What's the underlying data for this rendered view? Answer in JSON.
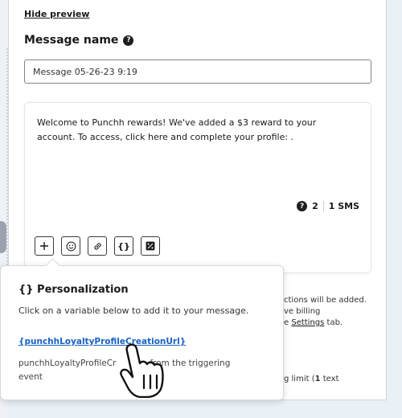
{
  "preview": {
    "hide_label": "Hide preview"
  },
  "message_name": {
    "label": "Message name",
    "help_icon": "help-icon",
    "value": "Message 05-26-23 9:19"
  },
  "composer": {
    "text": "Welcome to Punchh rewards! We've added a $3 reward to your account. To access, click here and complete your profile: .",
    "sms_count": "2",
    "sms_label": "1 SMS",
    "toolbar": [
      {
        "name": "insert-plus-button",
        "icon": "plus-icon",
        "glyph": "+"
      },
      {
        "name": "insert-emoji-button",
        "icon": "emoji-icon",
        "glyph": "☺"
      },
      {
        "name": "insert-link-button",
        "icon": "link-icon",
        "glyph": "∞"
      },
      {
        "name": "personalization-button",
        "icon": "curly-braces-icon",
        "glyph": "{}"
      },
      {
        "name": "insert-discount-button",
        "icon": "percent-icon",
        "glyph": "%"
      }
    ]
  },
  "background_notes": {
    "line1": "ctions will be added.",
    "line2": "ve billing",
    "line3_prefix": "e ",
    "line3_link": "Settings",
    "line3_suffix": " tab.",
    "line4_prefix": "g limit (",
    "line4_bold": "1",
    "line4_suffix": " text"
  },
  "popover": {
    "title": "{} Personalization",
    "description": "Click on a variable below to add it to your message.",
    "variable": "{punchhLoyaltyProfileCreationUrl}",
    "variable_desc_part1": "punchhLoyaltyProfileCr",
    "variable_desc_part2": "from the triggering",
    "variable_desc_part3": "event"
  },
  "colors": {
    "accent_link": "#1a62c2",
    "page_bg": "#e9f0f6",
    "panel_bg": "#ffffff"
  }
}
